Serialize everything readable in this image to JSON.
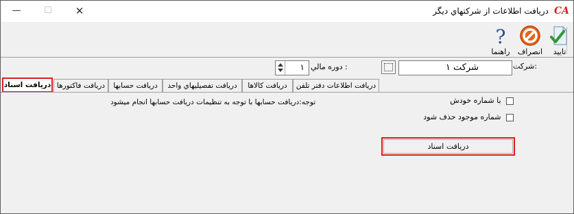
{
  "window": {
    "title": "دريافت اطلاعات از شرکتهاي ديگر",
    "logo_text": "CA",
    "minimize_glyph": "—",
    "maximize_glyph": "☐",
    "close_glyph": "✕"
  },
  "toolbar": {
    "ok_label": "تاييد",
    "cancel_label": "انصراف",
    "help_label": "راهنما",
    "ok_icon": "check-document-icon",
    "cancel_icon": "no-entry-icon",
    "help_icon": "question-mark-icon"
  },
  "params": {
    "company_label": "شرکت:",
    "company_value": "شرکت ۱",
    "period_label": "دوره مالي :",
    "period_value": "۱"
  },
  "tabs": [
    {
      "label": "دريافت اسناد",
      "active": true
    },
    {
      "label": "دريافت فاکتورها",
      "active": false
    },
    {
      "label": "دريافت حسابها",
      "active": false
    },
    {
      "label": "دريافت تفصيليهاي واحد",
      "active": false
    },
    {
      "label": "دريافت کالاها",
      "active": false
    },
    {
      "label": "دريافت اطلاعات دفتر تلفن",
      "active": false
    }
  ],
  "content": {
    "option_own_number": "با شماره خودش",
    "option_delete_existing": "شماره موجود حذف شود",
    "note": "توجه:دريافت حسابها با توجه به تنظيمات دريافت حسابها انجام ميشود",
    "action_button": "دريافت اسناد"
  },
  "colors": {
    "highlight": "#e01c1c",
    "face": "#f0f0f0"
  }
}
